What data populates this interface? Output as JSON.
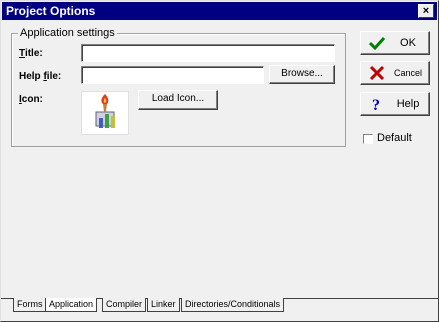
{
  "window": {
    "title": "Project Options",
    "close_glyph": "×"
  },
  "group": {
    "label": "Application settings"
  },
  "fields": {
    "title_label_ul": "T",
    "title_label_rest": "itle:",
    "title_value": "",
    "helpfile_label_pre": "Help ",
    "helpfile_label_ul": "f",
    "helpfile_label_rest": "ile:",
    "helpfile_value": "",
    "icon_label_ul": "I",
    "icon_label_rest": "con:"
  },
  "buttons": {
    "browse": "Browse...",
    "load_icon": "Load Icon...",
    "ok": "OK",
    "cancel": "Cancel",
    "help": "Help"
  },
  "checkbox": {
    "label": "Default",
    "checked": false
  },
  "tabs": [
    {
      "label": "Forms",
      "active": false
    },
    {
      "label": "Application",
      "active": true
    },
    {
      "label": "Compiler",
      "active": false
    },
    {
      "label": "Linker",
      "active": false
    },
    {
      "label": "Directories/Conditionals",
      "active": false
    }
  ],
  "colors": {
    "titlebar": "#000080",
    "face": "#f0f0f0",
    "ok_check": "#008000",
    "cancel_x": "#c00000",
    "help_q": "#0000c0"
  }
}
